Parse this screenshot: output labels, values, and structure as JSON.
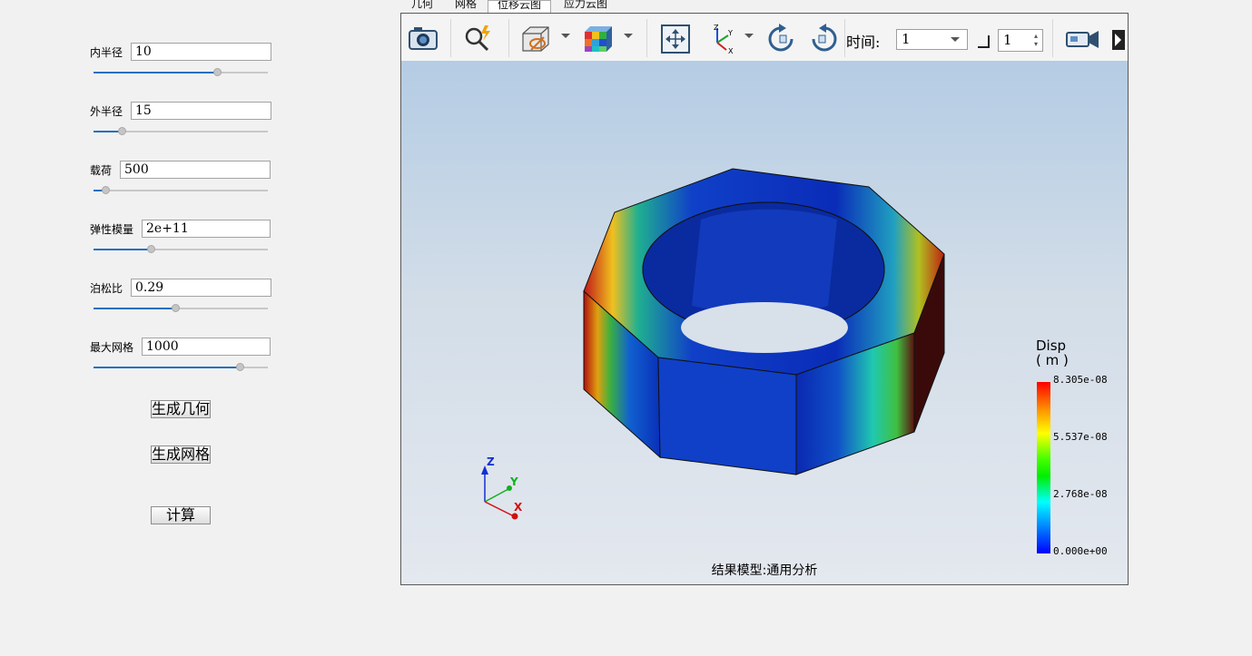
{
  "params": [
    {
      "label": "内半径",
      "value": "10",
      "slider": 0.71
    },
    {
      "label": "外半径",
      "value": "15",
      "slider": 0.16
    },
    {
      "label": "载荷",
      "value": "500",
      "slider": 0.07
    },
    {
      "label": "弹性模量",
      "value": "2e+11",
      "slider": 0.33
    },
    {
      "label": "泊松比",
      "value": "0.29",
      "slider": 0.47
    },
    {
      "label": "最大网格",
      "value": "1000",
      "slider": 0.84
    }
  ],
  "buttons": {
    "generate_geometry": "生成几何",
    "generate_mesh": "生成网格",
    "compute": "计算"
  },
  "tabs": [
    {
      "label": "几何",
      "active": false
    },
    {
      "label": "网格",
      "active": false
    },
    {
      "label": "位移云图",
      "active": true
    },
    {
      "label": "应力云图",
      "active": false
    }
  ],
  "toolbar": {
    "icons": [
      "camera-icon",
      "zoom-icon",
      "display-mode-icon",
      "color-cube-icon",
      "fit-view-icon",
      "axes-icon",
      "rotate-ccw-icon",
      "rotate-cw-icon",
      "video-icon"
    ],
    "time_label": "时间:",
    "time_value": "1",
    "step_value": "1"
  },
  "viewport": {
    "model_label": "结果模型:通用分析",
    "axes": {
      "z": "Z",
      "y": "Y",
      "x": "X"
    },
    "legend": {
      "title": "Disp",
      "unit": "( m )",
      "ticks": [
        "8.305e-08",
        "5.537e-08",
        "2.768e-08",
        "0.000e+00"
      ]
    }
  },
  "colors": {
    "slider_fill": "#1f6fbf",
    "legend_max": "#ff0000",
    "legend_min": "#0000ff"
  }
}
